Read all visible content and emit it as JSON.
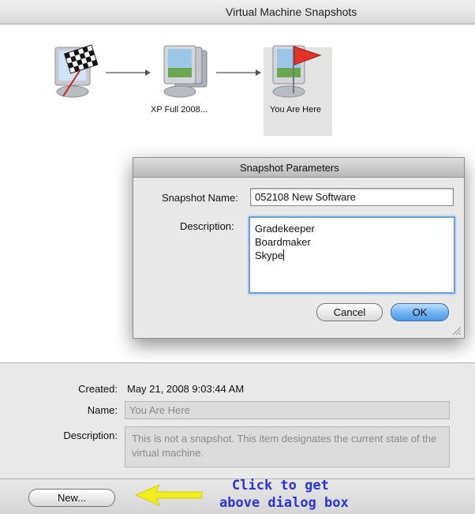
{
  "window": {
    "title": "Virtual Machine Snapshots"
  },
  "tree": {
    "nodes": [
      {
        "label": "",
        "icon": "checkered-flag-icon"
      },
      {
        "label": "XP Full 2008...",
        "icon": "snapshot-stack-icon"
      },
      {
        "label": "You Are Here",
        "icon": "red-flag-icon",
        "selected": true
      }
    ]
  },
  "dialog": {
    "title": "Snapshot Parameters",
    "name_label": "Snapshot Name:",
    "name_value": "052108 New Software",
    "description_label": "Description:",
    "description_lines": [
      "Gradekeeper",
      "Boardmaker",
      "Skype"
    ],
    "cancel_label": "Cancel",
    "ok_label": "OK"
  },
  "info": {
    "created_label": "Created:",
    "created_value": "May 21, 2008 9:03:44 AM",
    "name_label": "Name:",
    "name_value": "You Are Here",
    "description_label": "Description:",
    "description_value": "This is not a snapshot. This item designates the current state of the virtual machine."
  },
  "bottom": {
    "new_label": "New..."
  },
  "annotation": {
    "line1": "Click to get",
    "line2": "above dialog box",
    "color": "#2d33d6",
    "arrow_color": "#f2ee1e"
  }
}
